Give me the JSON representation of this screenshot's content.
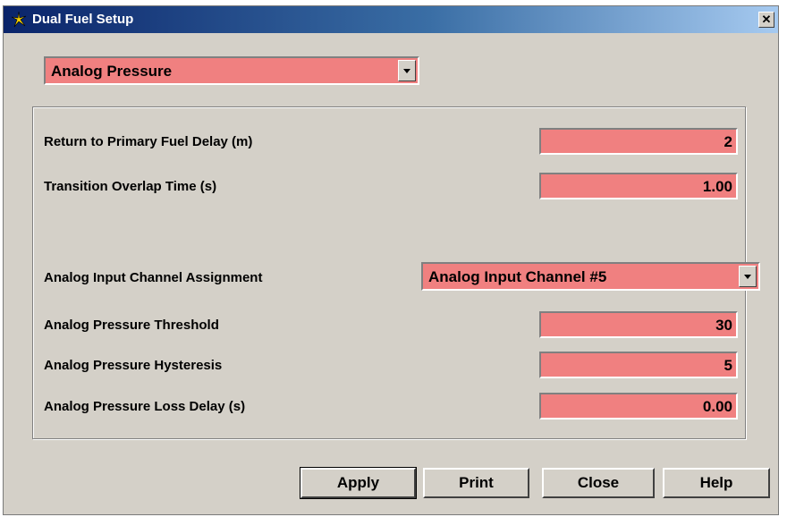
{
  "window": {
    "title": "Dual Fuel Setup",
    "close_label": "✕"
  },
  "mode_select": {
    "value": "Analog Pressure"
  },
  "fields": {
    "return_delay": {
      "label": "Return to Primary Fuel Delay (m)",
      "value": "2"
    },
    "transition_overlap": {
      "label": "Transition Overlap Time (s)",
      "value": "1.00"
    },
    "channel_assignment": {
      "label": "Analog Input Channel Assignment",
      "value": "Analog Input Channel #5"
    },
    "pressure_threshold": {
      "label": "Analog Pressure Threshold",
      "value": "30"
    },
    "pressure_hysteresis": {
      "label": "Analog Pressure Hysteresis",
      "value": "5"
    },
    "pressure_loss_delay": {
      "label": "Analog Pressure Loss Delay (s)",
      "value": "0.00"
    }
  },
  "buttons": {
    "apply": "Apply",
    "print": "Print",
    "close": "Close",
    "help": "Help"
  },
  "colors": {
    "field_background": "#f08080",
    "window_background": "#d4d0c8",
    "titlebar": "#0a246a"
  },
  "icons": {
    "title": "app-spark-icon",
    "dropdown": "chevron-down-icon"
  }
}
